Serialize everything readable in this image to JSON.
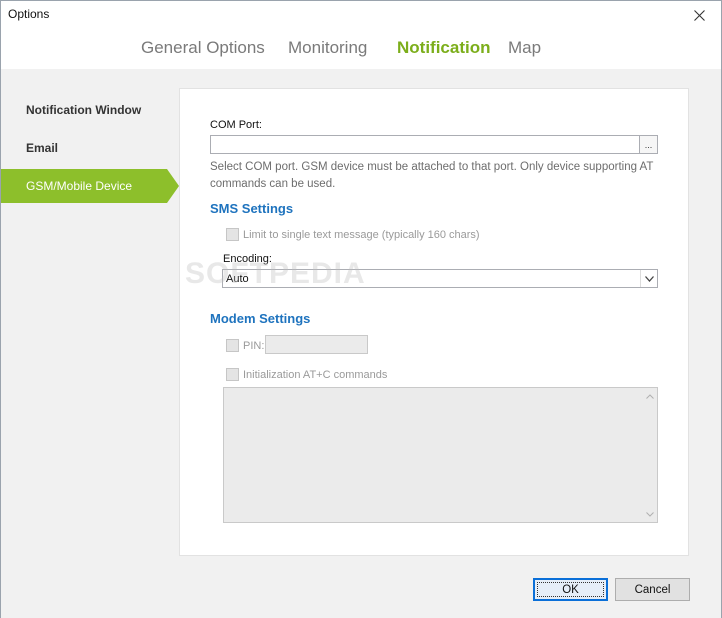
{
  "window": {
    "title": "Options"
  },
  "tabs": [
    {
      "label": "General Options",
      "active": false
    },
    {
      "label": "Monitoring",
      "active": false
    },
    {
      "label": "Notification",
      "active": true
    },
    {
      "label": "Map",
      "active": false
    }
  ],
  "sidebar": {
    "items": [
      {
        "label": "Notification Window",
        "selected": false
      },
      {
        "label": "Email",
        "selected": false
      },
      {
        "label": "GSM/Mobile Device",
        "selected": true
      }
    ]
  },
  "gsm": {
    "com_port_label": "COM Port:",
    "com_port_value": "",
    "browse_label": "...",
    "help_text": "Select COM port. GSM device must be attached to that port. Only device supporting AT commands can be used.",
    "sms_settings_title": "SMS Settings",
    "limit_label": "Limit to single text message (typically 160 chars)",
    "limit_checked": false,
    "encoding_label": "Encoding:",
    "encoding_value": "Auto",
    "modem_settings_title": "Modem Settings",
    "pin_label": "PIN:",
    "pin_checked": false,
    "pin_value": "",
    "init_label": "Initialization AT+C commands",
    "init_checked": false,
    "init_value": ""
  },
  "footer": {
    "ok_label": "OK",
    "cancel_label": "Cancel"
  },
  "watermark": "SOFTPEDIA",
  "colors": {
    "accent_green": "#8dbf2b",
    "active_tab": "#7cae1b",
    "section_blue": "#1e73be"
  }
}
